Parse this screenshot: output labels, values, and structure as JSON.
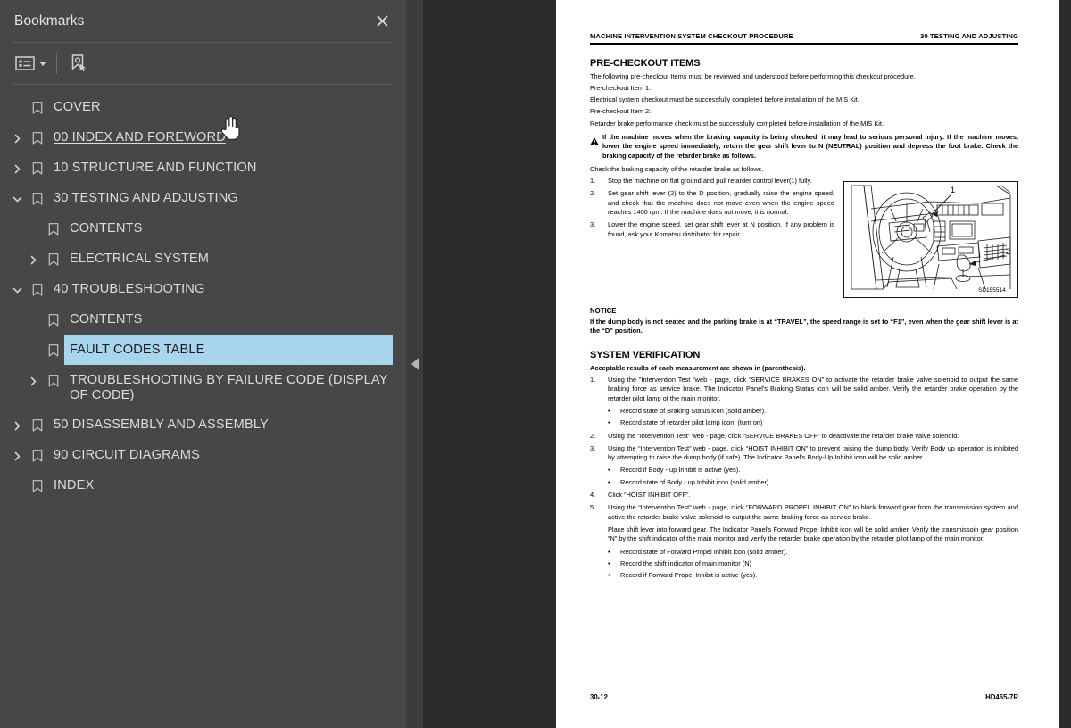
{
  "panel": {
    "title": "Bookmarks",
    "close_icon": "close-icon",
    "toolbar": {
      "options_label": "bookmark-options",
      "options_icon": "list-options-icon",
      "new_bookmark_icon": "new-bookmark-icon"
    },
    "collapse_icon": "collapse-panel-arrow-icon",
    "items": [
      {
        "label": "COVER",
        "level": 0,
        "twisty": "none",
        "state": "normal"
      },
      {
        "label": "00 INDEX AND FOREWORD",
        "level": 0,
        "twisty": "collapsed",
        "state": "hovered"
      },
      {
        "label": "10 STRUCTURE AND FUNCTION",
        "level": 0,
        "twisty": "collapsed",
        "state": "normal"
      },
      {
        "label": "30 TESTING AND ADJUSTING",
        "level": 0,
        "twisty": "expanded",
        "state": "normal"
      },
      {
        "label": "CONTENTS",
        "level": 1,
        "twisty": "none",
        "state": "normal"
      },
      {
        "label": "ELECTRICAL SYSTEM",
        "level": 1,
        "twisty": "collapsed",
        "state": "normal"
      },
      {
        "label": "40 TROUBLESHOOTING",
        "level": 0,
        "twisty": "expanded",
        "state": "normal"
      },
      {
        "label": "CONTENTS",
        "level": 1,
        "twisty": "none",
        "state": "normal"
      },
      {
        "label": "FAULT CODES TABLE",
        "level": 1,
        "twisty": "none",
        "state": "selected"
      },
      {
        "label": "TROUBLESHOOTING BY FAILURE CODE (DISPLAY OF CODE)",
        "level": 1,
        "twisty": "collapsed",
        "state": "normal"
      },
      {
        "label": "50 DISASSEMBLY AND ASSEMBLY",
        "level": 0,
        "twisty": "collapsed",
        "state": "normal"
      },
      {
        "label": "90 CIRCUIT DIAGRAMS",
        "level": 0,
        "twisty": "collapsed",
        "state": "normal"
      },
      {
        "label": "INDEX",
        "level": 0,
        "twisty": "none",
        "state": "normal"
      }
    ]
  },
  "document": {
    "running_head_left": "MACHINE INTERVENTION SYSTEM CHECKOUT PROCEDURE",
    "running_head_right": "30 TESTING AND ADJUSTING",
    "precheckout": {
      "heading": "PRE-CHECKOUT ITEMS",
      "intro": "The following pre-checkout Items must be reviewed and understood before performing this checkout procedure.",
      "item1_label": "Pre-checkout Item 1:",
      "item1_text": "Electrical system checkout must be successfully completed before installation of the MIS Kit.",
      "item2_label": "Pre-checkout Item 2:",
      "item2_text": "Retarder brake performance check must be successfully completed before installation of the MIS Kit.",
      "warning": "If the machine moves when the braking capacity is being checked, it may lead to serious personal injury. If the machine moves, lower the engine speed immediately, return the gear shift lever to N (NEUTRAL) position and depress the foot brake. Check the braking capacity of the retarder brake as follows.",
      "warning_icon": "warning-triangle-icon",
      "after_warning": "Check the braking capacity of the retarder brake as follows.",
      "steps": [
        {
          "num": "1.",
          "text": "Stop the machine on flat ground and pull retarder control lever(1) fully."
        },
        {
          "num": "2.",
          "text": "Set gear shift lever (2) to the D position, gradually raise the engine speed, and check that the machine does not move even when the engine speed reaches 1400 rpm. If the machine does not move, it is normal."
        },
        {
          "num": "3.",
          "text": "Lower the engine speed, set gear shift lever at N position. If any problem is found, ask your Komatsu distributor for repair."
        }
      ]
    },
    "figure": {
      "name": "operator-cab-interior-illustration",
      "callout_1": "1",
      "callout_2": "2",
      "figure_id": "SD155514"
    },
    "notice": {
      "heading": "NOTICE",
      "text": "If the dump body is not seated and the parking brake is at “TRAVEL”, the speed range is set to “F1”, even when the gear shift lever is at the “D” position."
    },
    "verification": {
      "heading": "SYSTEM VERIFICATION",
      "lead": "Acceptable results of each measurement are shown in (parenthesis).",
      "steps": [
        {
          "num": "1.",
          "text": "Using the ”Intervention Test ”web - page, click “SERVICE BRAKES ON” to activate the retarder brake valve solenoid to output the same braking force as service brake. The Indicator Panel's Braking Status icon will be solid amber. Verify the retarder brake operation by the retarder pilot lamp of the main monitor.",
          "bullets": [
            "Record state of Braking Status icon (solid amber).",
            "Record state of retarder pilot lamp icon. (turn on)"
          ]
        },
        {
          "num": "2.",
          "text": "Using the “Intervention Test” web - page, click “SERVICE BRAKES OFF” to deactivate the retarder brake valve solenoid.",
          "bullets": []
        },
        {
          "num": "3.",
          "text": "Using the “Intervention Test” web - page, click “HOIST INHIBIT ON” to prevent raising the dump body. Verify Body up operation is inhibited by attempting to raise the dump body (if safe). The Indicator Panel's Body-Up Inhibit icon will be solid amber.",
          "bullets": [
            "Record if Body - up Inhibit is active (yes).",
            "Record state of Body - up Inhibit icon (solid amber)."
          ]
        },
        {
          "num": "4.",
          "text": "Click “HOIST INHIBIT OFF”.",
          "bullets": []
        },
        {
          "num": "5.",
          "text": "Using the “Intervention Test” web - page, click “FORWARD PROPEL INHIBIT ON” to block forward gear from the transmission system and active the retarder brake valve solenoid to output the same braking force as service brake.",
          "bullets": []
        }
      ],
      "closing_paragraph": "Place shift lever into forward gear. The Indicator Panel's Forward Propel Inhibit icon will be solid amber. Verify the transmissoin gear position “N” by the shift indicator of the main monitor and verify the retarder brake operation by the retarder pilot lamp of the main monitor.",
      "closing_bullets": [
        "Record state of Forward Propel Inhibit icon (solid amber).",
        "Record the shift indicator of main monitor (N)",
        "Record if Forward Propel Inhibit is active (yes)."
      ]
    },
    "footer_left": "30-12",
    "footer_right": "HD465-7R"
  },
  "colors": {
    "panel_bg": "#474747",
    "viewer_bg": "#2b2b2b",
    "selection": "#a8d4ee",
    "gutter": "#3c3c3c"
  }
}
